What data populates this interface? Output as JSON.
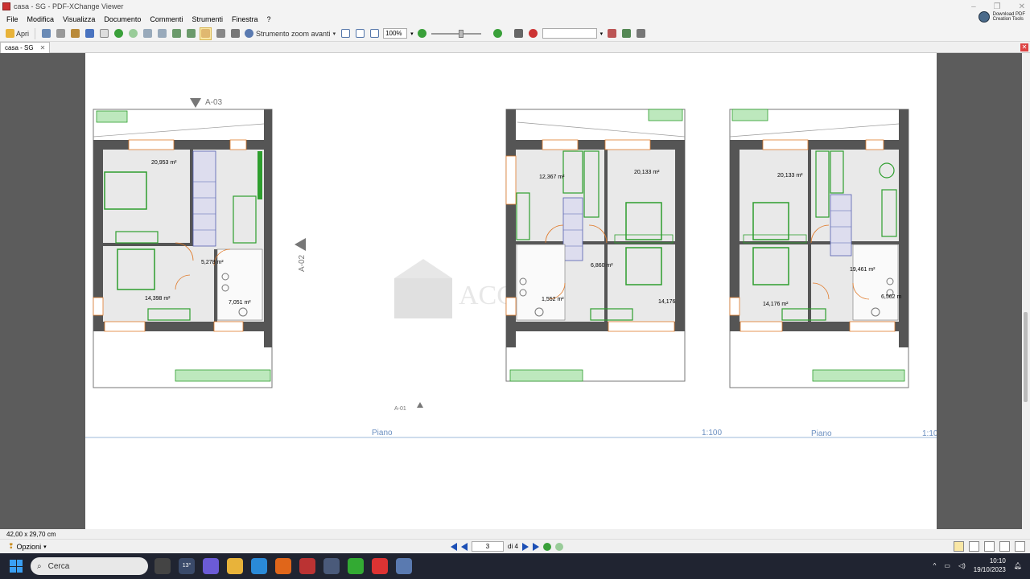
{
  "window": {
    "title": "casa - SG - PDF-XChange Viewer"
  },
  "menu": [
    "File",
    "Modifica",
    "Visualizza",
    "Documento",
    "Commenti",
    "Strumenti",
    "Finestra",
    "?"
  ],
  "download": {
    "line1": "Download PDF",
    "line2": "Creation Tools"
  },
  "toolbar": {
    "open_label": "Apri",
    "zoom_tool_label": "Strumento zoom avanti",
    "zoom_value": "100%"
  },
  "tab": {
    "label": "casa - SG"
  },
  "drawing": {
    "section_markers": [
      "A-03",
      "A-02",
      "A-01"
    ],
    "plan1": {
      "areas": [
        "20,953 m²",
        "14,398 m²",
        "5,278 m²",
        "7,051 m²"
      ]
    },
    "plan2": {
      "areas": [
        "12,367 m²",
        "20,133 m²",
        "6,860 m²",
        "1,552 m²",
        "14,176"
      ]
    },
    "plan3": {
      "areas": [
        "20,133 m²",
        "19,461 m²",
        "14,176 m²",
        "6,562 m"
      ]
    },
    "labels": [
      "Piano",
      "1:100",
      "Piano",
      "1:10"
    ],
    "watermark": "ACCORDI"
  },
  "status": {
    "page_size": "42,00 x 29,70 cm"
  },
  "navigation": {
    "options_label": "Opzioni",
    "current_page": "3",
    "page_total": "di 4"
  },
  "taskbar": {
    "search_placeholder": "Cerca",
    "weather": "13°",
    "time": "10:10",
    "date": "19/10/2023"
  },
  "colors": {
    "wall": "#555555",
    "furniture": "#2e9e2e",
    "door": "#e07a2a",
    "stairs": "#5560b0",
    "floor": "#e9e9e9"
  }
}
